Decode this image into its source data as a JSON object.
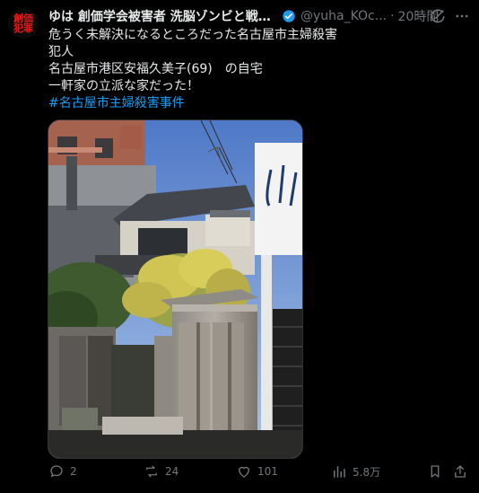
{
  "avatar": {
    "text_line1": "創価",
    "text_line2": "犯罪"
  },
  "header": {
    "display_name": "ゆは 創価学会被害者 洗脳ゾンビと戦う...",
    "handle": "@yuha_KOc...",
    "separator": "·",
    "time": "20時間"
  },
  "post": {
    "lines": [
      "危うく未解決になるところだった名古屋市主婦殺害",
      "犯人",
      "名古屋市港区安福久美子(69)　の自宅",
      "一軒家の立派な家だった！"
    ],
    "hashtag": "#名古屋市主婦殺害事件"
  },
  "actions": {
    "reply_count": "2",
    "repost_count": "24",
    "like_count": "101",
    "views_count": "5.8万"
  },
  "colors": {
    "accent": "#1d9bf0",
    "muted": "#71767b",
    "background": "#000000",
    "text": "#e7e9ea"
  },
  "icons": [
    "verified-badge-icon",
    "grok-icon",
    "more-icon",
    "reply-icon",
    "repost-icon",
    "like-icon",
    "views-icon",
    "bookmark-icon",
    "share-icon"
  ]
}
